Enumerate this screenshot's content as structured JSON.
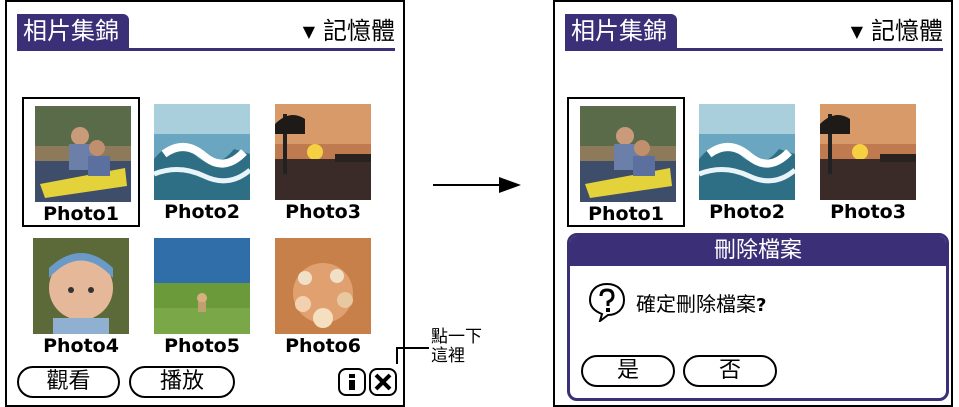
{
  "left_screen": {
    "app_title": "相片集錦",
    "category": "記憶體",
    "photos": [
      {
        "label": "Photo1",
        "selected": true
      },
      {
        "label": "Photo2",
        "selected": false
      },
      {
        "label": "Photo3",
        "selected": false
      },
      {
        "label": "Photo4",
        "selected": false
      },
      {
        "label": "Photo5",
        "selected": false
      },
      {
        "label": "Photo6",
        "selected": false
      }
    ],
    "buttons": {
      "view": "觀看",
      "play": "播放"
    },
    "icons": {
      "info": "info-icon",
      "delete": "delete-x-icon"
    }
  },
  "callout": {
    "line1": "點一下",
    "line2": "這裡"
  },
  "right_screen": {
    "app_title": "相片集錦",
    "category": "記憶體",
    "photos": [
      {
        "label": "Photo1",
        "selected": true
      },
      {
        "label": "Photo2",
        "selected": false
      },
      {
        "label": "Photo3",
        "selected": false
      }
    ],
    "dialog": {
      "title": "刪除檔案",
      "message": "確定刪除檔案",
      "message_mark": "?",
      "yes": "是",
      "no": "否"
    }
  },
  "colors": {
    "accent": "#3b2f78"
  }
}
